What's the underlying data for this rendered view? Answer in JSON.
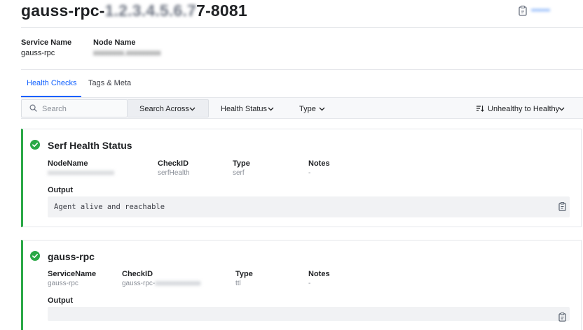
{
  "header": {
    "title_prefix": "gauss-rpc-",
    "title_blurred": "1.2.3.4.5.6.7",
    "title_suffix": "7-8081",
    "copy_label": "•••••••"
  },
  "meta": {
    "service_name_label": "Service Name",
    "service_name_value": "gauss-rpc",
    "node_name_label": "Node Name",
    "node_name_value": "xxxxxxxx.xxxxxxxxx"
  },
  "tabs": [
    {
      "label": "Health Checks",
      "active": true
    },
    {
      "label": "Tags & Meta",
      "active": false
    }
  ],
  "toolbar": {
    "search_placeholder": "Search",
    "search_across": "Search Across",
    "health_status": "Health Status",
    "type": "Type",
    "sort": "Unhealthy to Healthy"
  },
  "checks": [
    {
      "title": "Serf Health Status",
      "status_color": "#2aa846",
      "cols": [
        {
          "label": "NodeName",
          "value": "xxxxxxxxxxxxxxxxxxx"
        },
        {
          "label": "CheckID",
          "value": "serfHealth"
        },
        {
          "label": "Type",
          "value": "serf"
        },
        {
          "label": "Notes",
          "value": "-"
        }
      ],
      "output_label": "Output",
      "output": "Agent alive and reachable"
    },
    {
      "title": "gauss-rpc",
      "status_color": "#2aa846",
      "cols": [
        {
          "label": "ServiceName",
          "value": "gauss-rpc"
        },
        {
          "label": "CheckID",
          "value": "gauss-rpc-",
          "value_blurred": "xxxxxxxxxxxxx"
        },
        {
          "label": "Type",
          "value": "ttl"
        },
        {
          "label": "Notes",
          "value": "-"
        }
      ],
      "output_label": "Output",
      "output": ""
    }
  ]
}
